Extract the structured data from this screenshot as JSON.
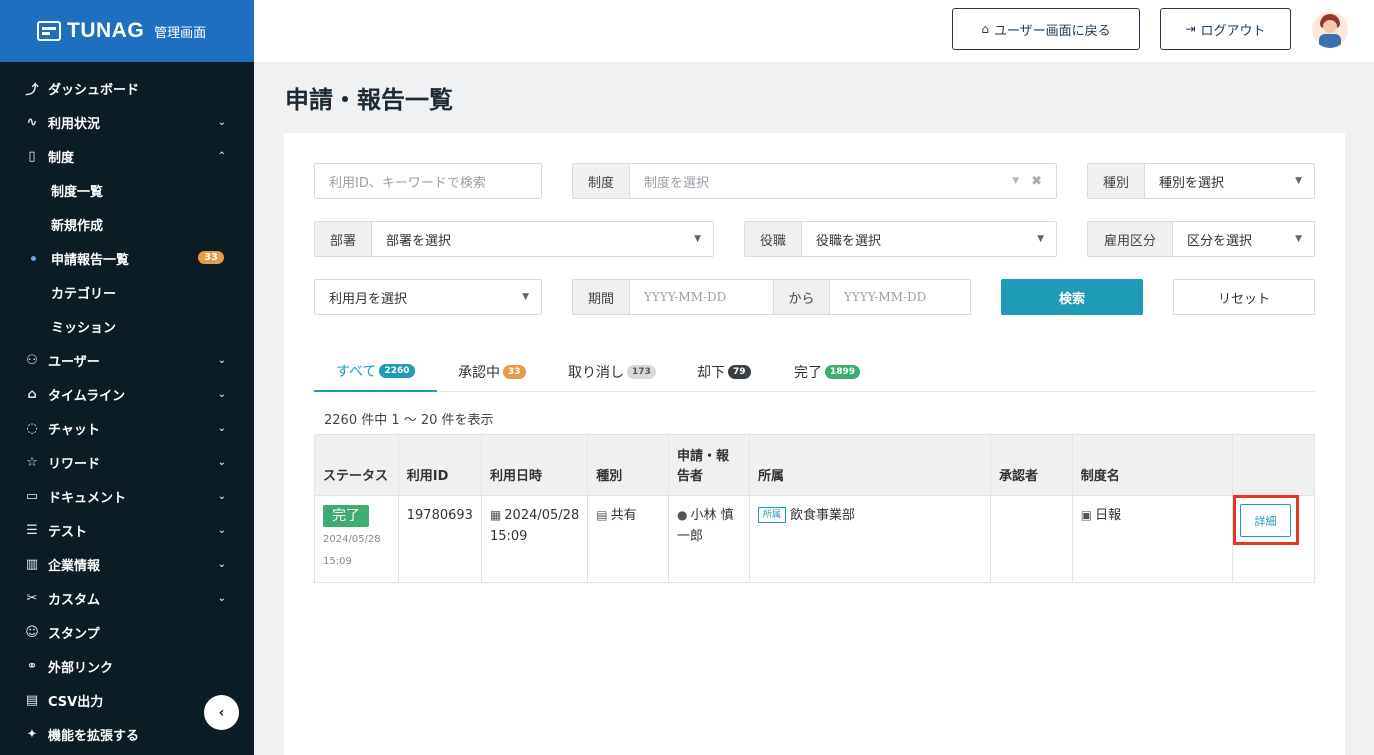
{
  "brand": {
    "name": "TUNAG",
    "sub": "管理画面"
  },
  "sidebar": {
    "items": [
      {
        "label": "ダッシュボード",
        "icon": "chart-line-icon",
        "glyph": "⤴"
      },
      {
        "label": "利用状況",
        "icon": "pulse-icon",
        "glyph": "∿",
        "chevron": "⌄"
      },
      {
        "label": "制度",
        "icon": "book-icon",
        "glyph": "▯",
        "chevron": "⌃"
      },
      {
        "label": "ユーザー",
        "icon": "users-icon",
        "glyph": "⚇",
        "chevron": "⌄"
      },
      {
        "label": "タイムライン",
        "icon": "home-icon",
        "glyph": "⌂",
        "chevron": "⌄"
      },
      {
        "label": "チャット",
        "icon": "chat-icon",
        "glyph": "◌",
        "chevron": "⌄"
      },
      {
        "label": "リワード",
        "icon": "star-icon",
        "glyph": "☆",
        "chevron": "⌄"
      },
      {
        "label": "ドキュメント",
        "icon": "folder-icon",
        "glyph": "▭",
        "chevron": "⌄"
      },
      {
        "label": "テスト",
        "icon": "list-icon",
        "glyph": "☰",
        "chevron": "⌄"
      },
      {
        "label": "企業情報",
        "icon": "building-icon",
        "glyph": "▥",
        "chevron": "⌄"
      },
      {
        "label": "カスタム",
        "icon": "tools-icon",
        "glyph": "✂",
        "chevron": "⌄"
      },
      {
        "label": "スタンプ",
        "icon": "smile-icon",
        "glyph": "☺"
      },
      {
        "label": "外部リンク",
        "icon": "link-icon",
        "glyph": "⚭"
      },
      {
        "label": "CSV出力",
        "icon": "table-icon",
        "glyph": "▤"
      },
      {
        "label": "機能を拡張する",
        "icon": "sparkle-icon",
        "glyph": "✦"
      }
    ],
    "sub_items": [
      {
        "label": "制度一覧"
      },
      {
        "label": "新規作成"
      },
      {
        "label": "申請報告一覧",
        "badge": "33"
      },
      {
        "label": "カテゴリー"
      },
      {
        "label": "ミッション"
      }
    ],
    "collapse_glyph": "‹"
  },
  "header": {
    "user_screen_button": "ユーザー画面に戻る",
    "logout_button": "ログアウト"
  },
  "main": {
    "title": "申請・報告一覧",
    "filters": {
      "keyword_placeholder": "利用ID、キーワードで検索",
      "system_label": "制度",
      "system_placeholder": "制度を選択",
      "type_label": "種別",
      "type_placeholder": "種別を選択",
      "department_label": "部署",
      "department_placeholder": "部署を選択",
      "position_label": "役職",
      "position_placeholder": "役職を選択",
      "employment_label": "雇用区分",
      "employment_placeholder": "区分を選択",
      "month_placeholder": "利用月を選択",
      "period_label": "期間",
      "from_placeholder": "YYYY-MM-DD",
      "kara_label": "から",
      "to_placeholder": "YYYY-MM-DD",
      "search_button": "検索",
      "reset_button": "リセット"
    },
    "tabs": [
      {
        "label": "すべて",
        "count": "2260",
        "color": "#1f9bb5"
      },
      {
        "label": "承認中",
        "count": "33",
        "color": "#e89a4b"
      },
      {
        "label": "取り消し",
        "count": "173",
        "color": "#d6d9dc"
      },
      {
        "label": "却下",
        "count": "79",
        "color": "#3a3f44"
      },
      {
        "label": "完了",
        "count": "1899",
        "color": "#3fad72"
      }
    ],
    "count_text": "2260 件中 1 〜 20 件を表示",
    "table": {
      "headers": [
        "ステータス",
        "利用ID",
        "利用日時",
        "種別",
        "申請・報告者",
        "所属",
        "承認者",
        "制度名",
        ""
      ],
      "row": {
        "status": "完了",
        "status_time": "2024/05/28 15:09",
        "id": "19780693",
        "datetime": "2024/05/28 15:09",
        "type": "共有",
        "applicant": "小林 慎一郎",
        "dept_tag": "所属",
        "dept": "飲食事業部",
        "approver": "",
        "system_name": "日報",
        "detail_button": "詳細"
      }
    }
  }
}
